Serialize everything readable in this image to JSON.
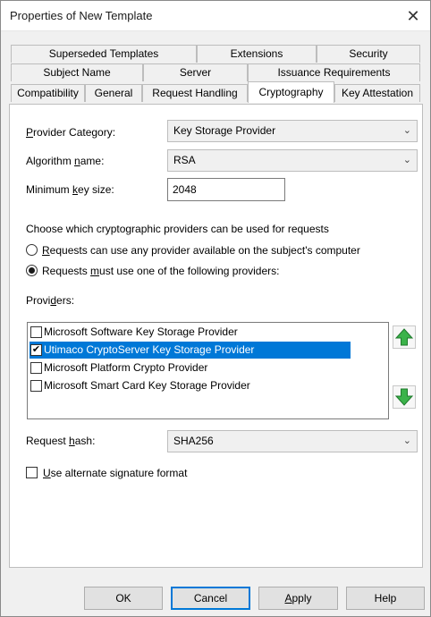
{
  "window": {
    "title": "Properties of New Template",
    "close_glyph": "✕"
  },
  "tabs": {
    "row1": [
      "Superseded Templates",
      "Extensions",
      "Security"
    ],
    "row2": [
      "Subject Name",
      "Server",
      "Issuance Requirements"
    ],
    "row3": [
      "Compatibility",
      "General",
      "Request Handling",
      "Cryptography",
      "Key Attestation"
    ],
    "active": "Cryptography"
  },
  "crypto": {
    "provider_category": {
      "label_pre": "",
      "label_u": "P",
      "label_post": "rovider Category:",
      "value": "Key Storage Provider"
    },
    "algorithm": {
      "label_pre": "Algorithm ",
      "label_u": "n",
      "label_post": "ame:",
      "value": "RSA"
    },
    "min_key": {
      "label_pre": "Minimum ",
      "label_u": "k",
      "label_post": "ey size:",
      "value": "2048"
    },
    "choose_text": "Choose which cryptographic providers can be used for requests",
    "radio_any": {
      "u": "R",
      "rest": "equests can use any provider available on the subject's computer",
      "selected": false
    },
    "radio_must": {
      "pre": "Requests ",
      "u": "m",
      "rest": "ust use one of the following providers:",
      "selected": true
    },
    "providers_label": {
      "pre": "Provi",
      "u": "d",
      "post": "ers:"
    },
    "providers": [
      {
        "name": "Microsoft Software Key Storage Provider",
        "checked": false,
        "selected": false
      },
      {
        "name": "Utimaco CryptoServer Key Storage Provider",
        "checked": true,
        "selected": true
      },
      {
        "name": "Microsoft Platform Crypto Provider",
        "checked": false,
        "selected": false
      },
      {
        "name": "Microsoft Smart Card Key Storage Provider",
        "checked": false,
        "selected": false
      }
    ],
    "request_hash": {
      "label_pre": "Request ",
      "label_u": "h",
      "label_post": "ash:",
      "value": "SHA256"
    },
    "alt_sig": {
      "u": "U",
      "rest": "se alternate signature format",
      "checked": false
    }
  },
  "buttons": {
    "ok": "OK",
    "cancel": "Cancel",
    "apply_u": "A",
    "apply_rest": "pply",
    "help": "Help"
  },
  "colors": {
    "selection": "#0078d7",
    "arrow_green": "#3bb34a"
  }
}
